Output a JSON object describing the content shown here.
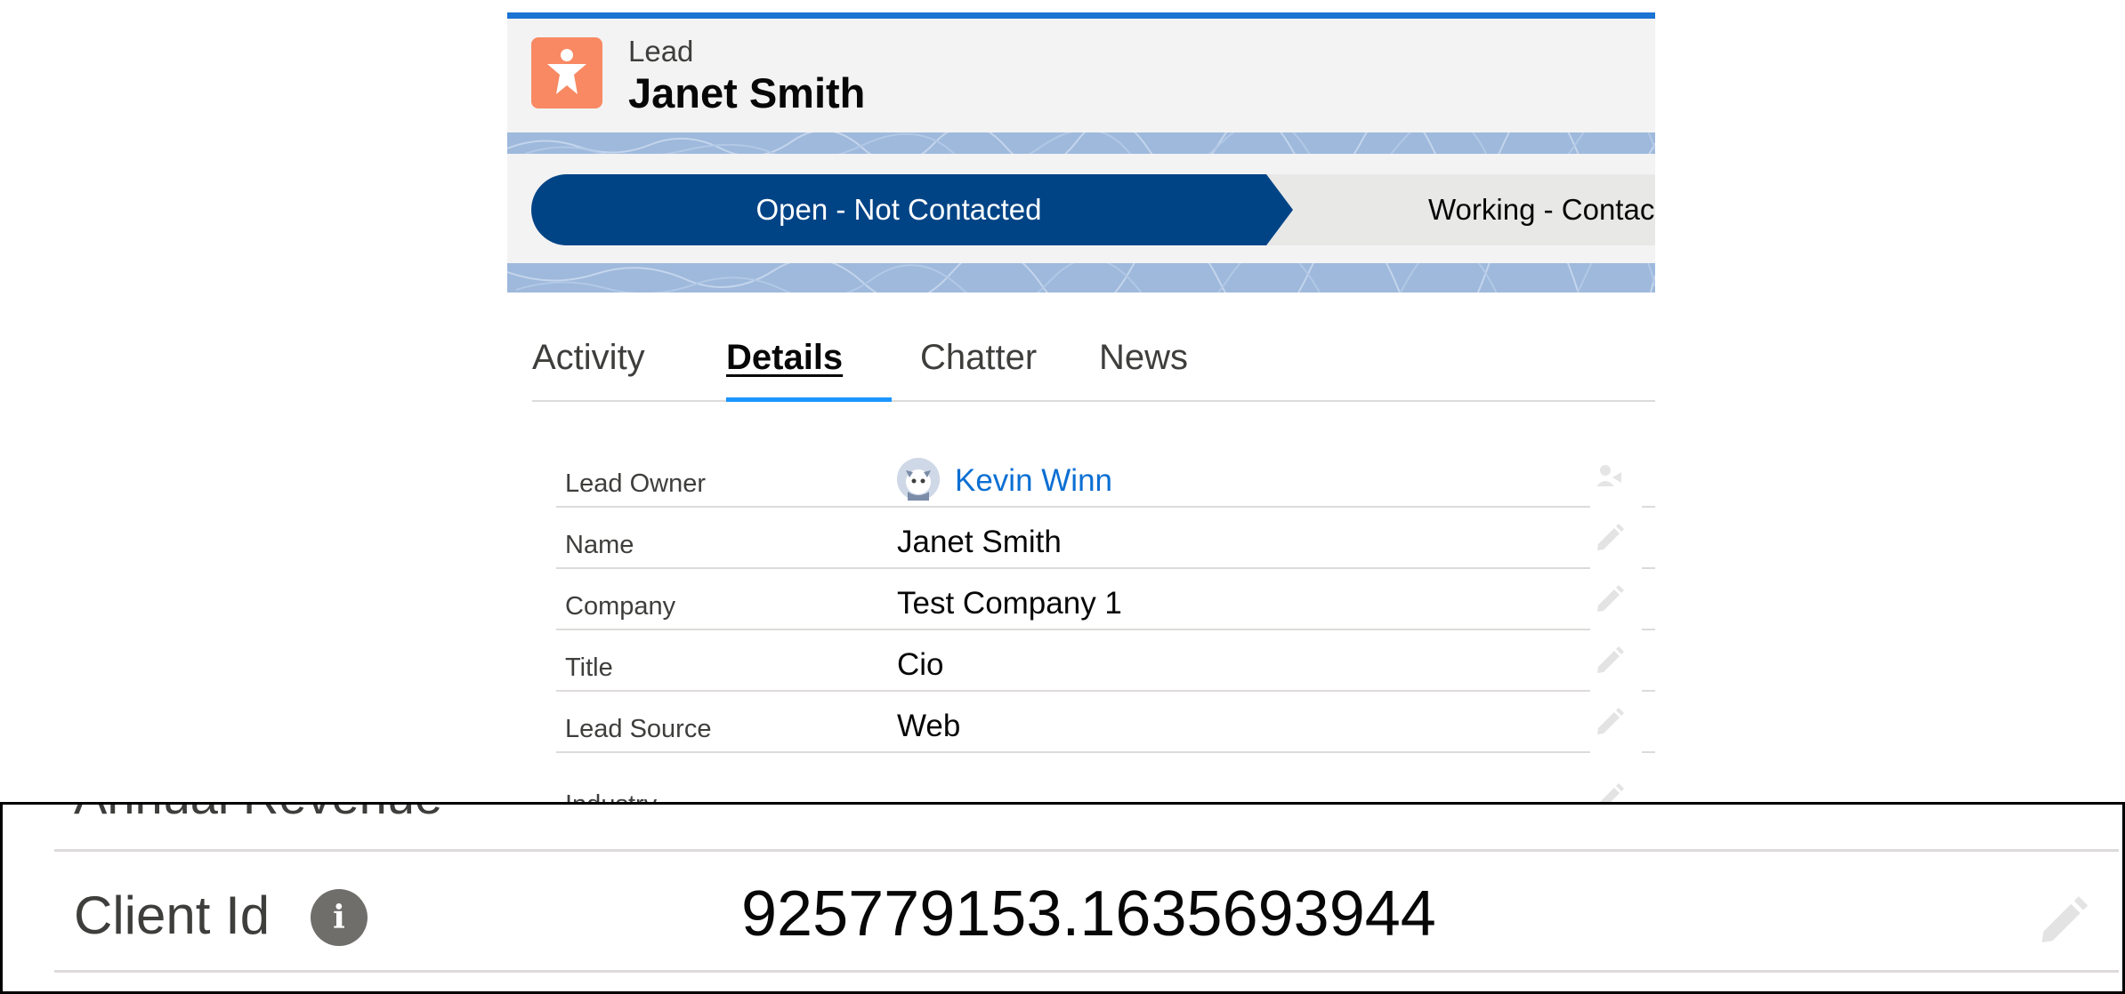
{
  "record": {
    "object_type": "Lead",
    "name": "Janet Smith",
    "icon": "lead-icon",
    "icon_color": "#f88962"
  },
  "path": {
    "current_stage": "Open - Not Contacted",
    "next_stage": "Working - Contac",
    "current_color": "#014486"
  },
  "tabs": [
    {
      "label": "Activity"
    },
    {
      "label": "Details",
      "active": true
    },
    {
      "label": "Chatter"
    },
    {
      "label": "News"
    }
  ],
  "fields": {
    "lead_owner": {
      "label": "Lead Owner",
      "value": "Kevin Winn"
    },
    "name": {
      "label": "Name",
      "value": "Janet Smith"
    },
    "company": {
      "label": "Company",
      "value": "Test Company 1"
    },
    "title": {
      "label": "Title",
      "value": "Cio"
    },
    "lead_source": {
      "label": "Lead Source",
      "value": "Web"
    },
    "industry": {
      "label": "Industry",
      "value": ""
    }
  },
  "callout": {
    "prev_label": "Annual Revenue",
    "client_id_label": "Client Id",
    "client_id_value": "925779153.1635693944",
    "info_icon": "info-icon"
  },
  "colors": {
    "accent": "#1b73d4",
    "link": "#0b6fd3",
    "tab_indicator": "#1b96ff"
  }
}
